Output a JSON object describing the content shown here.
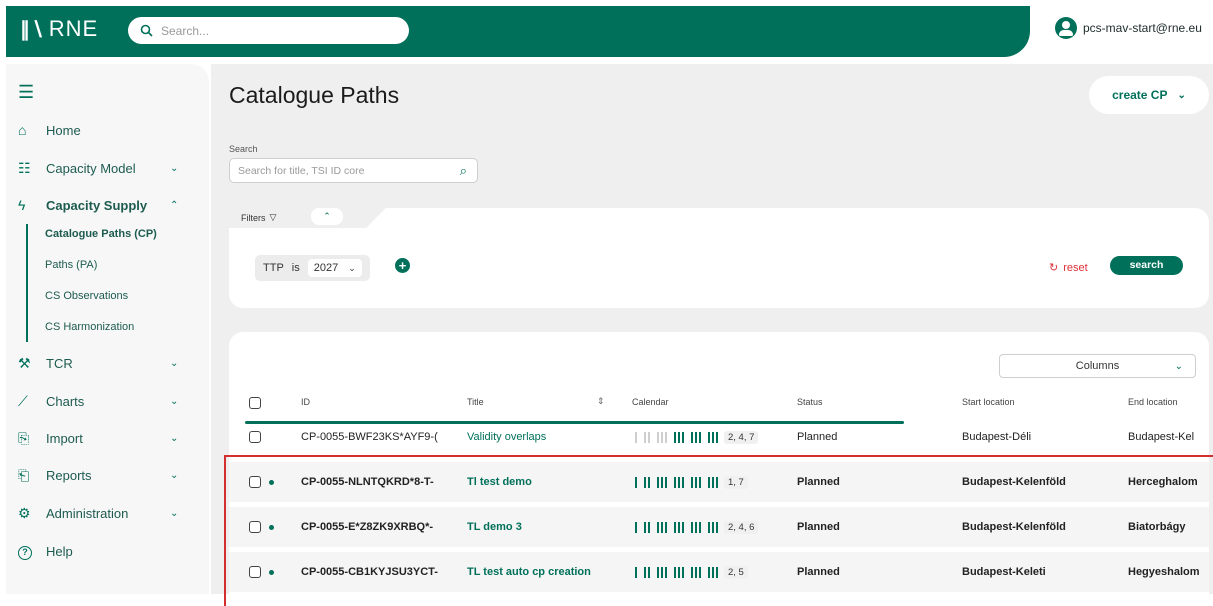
{
  "app": {
    "logo_text": "RNE",
    "logo_mark": "∥∖",
    "search_placeholder": "Search...",
    "user_email": "pcs-mav-start@rne.eu"
  },
  "sidebar": {
    "items": [
      {
        "label": "Home",
        "icon": "home-icon",
        "glyph": "⌂"
      },
      {
        "label": "Capacity Model",
        "icon": "capacity-model-icon",
        "glyph": "☷"
      },
      {
        "label": "Capacity Supply",
        "icon": "capacity-supply-icon",
        "glyph": "ϟ"
      },
      {
        "label": "TCR",
        "icon": "tcr-icon",
        "glyph": "⚒"
      },
      {
        "label": "Charts",
        "icon": "chart-icon",
        "glyph": "⟋"
      },
      {
        "label": "Import",
        "icon": "import-icon",
        "glyph": "⎘"
      },
      {
        "label": "Reports",
        "icon": "reports-icon",
        "glyph": "⎗"
      },
      {
        "label": "Administration",
        "icon": "administration-icon",
        "glyph": "⚙"
      },
      {
        "label": "Help",
        "icon": "help-icon",
        "glyph": "?"
      }
    ],
    "sub_items": [
      "Catalogue Paths (CP)",
      "Paths (PA)",
      "CS Observations",
      "CS Harmonization"
    ]
  },
  "main": {
    "title": "Catalogue Paths",
    "create_label": "create CP",
    "search_label": "Search",
    "search_placeholder": "Search for title, TSI ID core",
    "filters_label": "Filters",
    "filter": {
      "field": "TTP",
      "op": "is",
      "value": "2027"
    },
    "reset_label": "reset",
    "search_button": "search",
    "columns_label": "Columns"
  },
  "table": {
    "headers": [
      "ID",
      "Title",
      "Calendar",
      "Status",
      "Start location",
      "End location"
    ],
    "rows": [
      {
        "id": "CP-0055-BWF23KS*AYF9-(",
        "title": "Validity overlaps",
        "days": "2, 4, 7",
        "status": "Planned",
        "start": "Budapest-Déli",
        "end": "Budapest-Kel"
      },
      {
        "id": "CP-0055-NLNTQKRD*8-T-",
        "title": "Tl test demo",
        "days": "1, 7",
        "status": "Planned",
        "start": "Budapest-Kelenföld",
        "end": "Herceghalom"
      },
      {
        "id": "CP-0055-E*Z8ZK9XRBQ*-",
        "title": "TL demo 3",
        "days": "2, 4, 6",
        "status": "Planned",
        "start": "Budapest-Kelenföld",
        "end": "Biatorbágy"
      },
      {
        "id": "CP-0055-CB1KYJSU3YCT-",
        "title": "TL test auto cp creation",
        "days": "2, 5",
        "status": "Planned",
        "start": "Budapest-Keleti",
        "end": "Hegyeshalom"
      }
    ]
  },
  "colors": {
    "brand": "#00705a",
    "danger": "#e0303a",
    "highlight": "#d32f2f"
  }
}
